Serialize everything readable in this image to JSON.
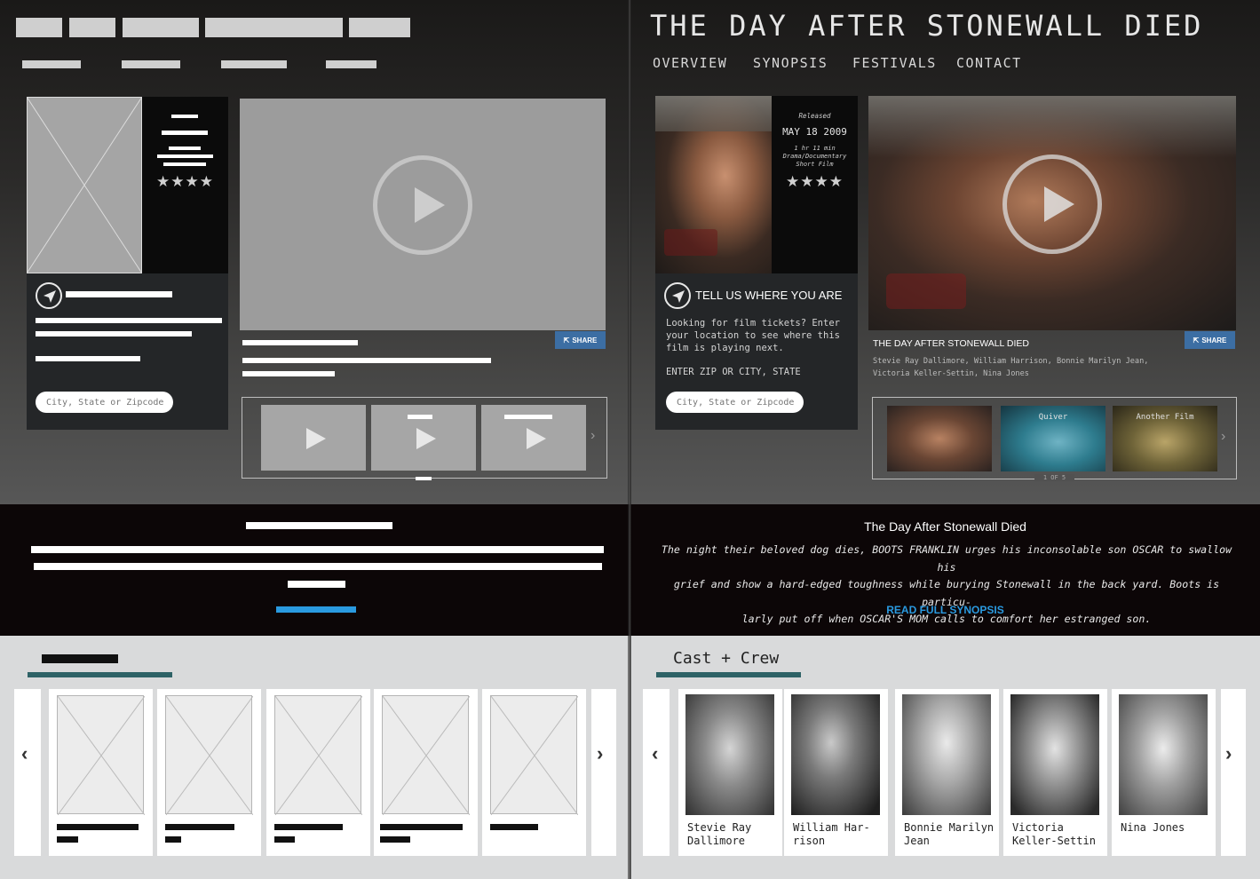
{
  "site": {
    "title": "THE DAY AFTER STONEWALL DIED",
    "nav": [
      "OVERVIEW",
      "SYNOPSIS",
      "FESTIVALS",
      "CONTACT"
    ]
  },
  "film": {
    "released_label": "Released",
    "release_date": "MAY 18 2009",
    "runtime": "1 hr 11 min",
    "genre": "Drama/Documentary",
    "format": "Short Film",
    "rating": "★★★★",
    "video_title": "THE DAY AFTER STONEWALL DIED",
    "credits_line1": "Stevie Ray Dallimore, William Harrison, Bonnie Marilyn Jean,",
    "credits_line2": "Victoria Keller-Settin, Nina Jones",
    "share_label": "SHARE"
  },
  "location": {
    "heading": "TELL US WHERE YOU ARE",
    "desc_line1": "Looking for film tickets? Enter",
    "desc_line2": "your location to see where this",
    "desc_line3": "film is playing next.",
    "prompt": "ENTER ZIP OR CITY, STATE",
    "placeholder": "City, State or Zipcode"
  },
  "carousel": {
    "thumbs": [
      "",
      "Quiver",
      "Another Film"
    ],
    "pager": "1 OF 5"
  },
  "synopsis": {
    "title": "The Day After Stonewall Died",
    "line1": "The night their beloved dog dies, BOOTS FRANKLIN urges his inconsolable son OSCAR to swallow his",
    "line2": "grief and show a hard-edged toughness while burying Stonewall in the back yard. Boots is particu-",
    "line3": "larly put off when OSCAR'S MOM calls to comfort her estranged son.",
    "read_more": "READ FULL SYNOPSIS"
  },
  "cast": {
    "heading": "Cast + Crew",
    "members": [
      {
        "line1": "Stevie Ray",
        "line2": "Dallimore"
      },
      {
        "line1": "William Har-",
        "line2": "rison"
      },
      {
        "line1": "Bonnie Marilyn",
        "line2": "Jean"
      },
      {
        "line1": "Victoria",
        "line2": "Keller-Settin"
      },
      {
        "line1": "Nina Jones",
        "line2": ""
      }
    ]
  },
  "wireframe": {
    "rating": "★★★★",
    "city_placeholder": "City, State or Zipcode",
    "share_label": "SHARE"
  },
  "colors": {
    "accent_blue": "#2a9ae0",
    "share_blue": "#3c6ea3",
    "teal_bar": "#2e6266"
  }
}
